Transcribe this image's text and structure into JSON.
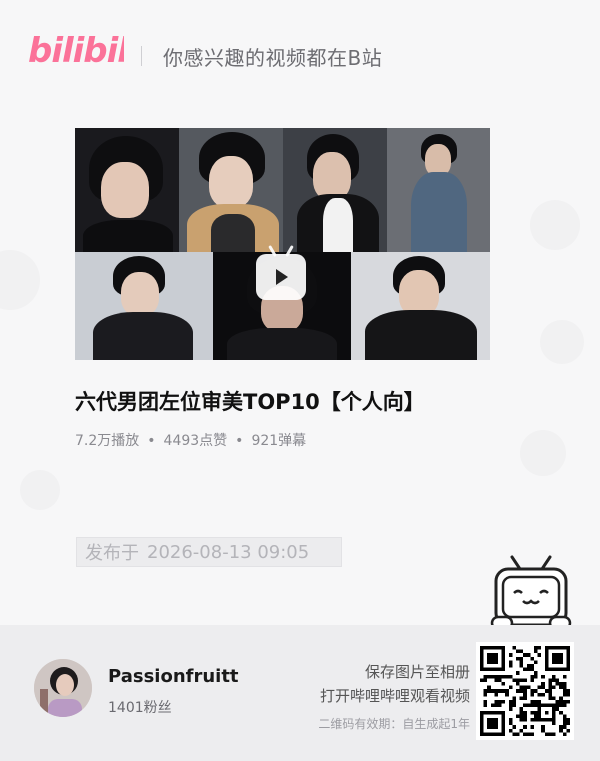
{
  "header": {
    "logo_text": "bilibili",
    "slogan": "你感兴趣的视频都在B站"
  },
  "video": {
    "title": "六代男团左位审美TOP10【个人向】",
    "stats": {
      "views": "7.2万播放",
      "likes": "4493点赞",
      "danmaku": "921弹幕",
      "separator": "•"
    },
    "publish_label": "发布于",
    "publish_time": "2026-08-13 09:05"
  },
  "uploader": {
    "name": "Passionfruitt",
    "fans": "1401粉丝"
  },
  "share": {
    "save_hint": "保存图片至相册",
    "open_hint": "打开哔哩哔哩观看视频",
    "validity": "二维码有效期：自生成起1年"
  },
  "colors": {
    "brand_pink": "#fb7299",
    "background": "#f7f7f8",
    "footer_bg": "#ededef"
  },
  "icons": [
    "bilibili-logo",
    "play-icon",
    "tv-mascot-icon",
    "qr-code"
  ]
}
